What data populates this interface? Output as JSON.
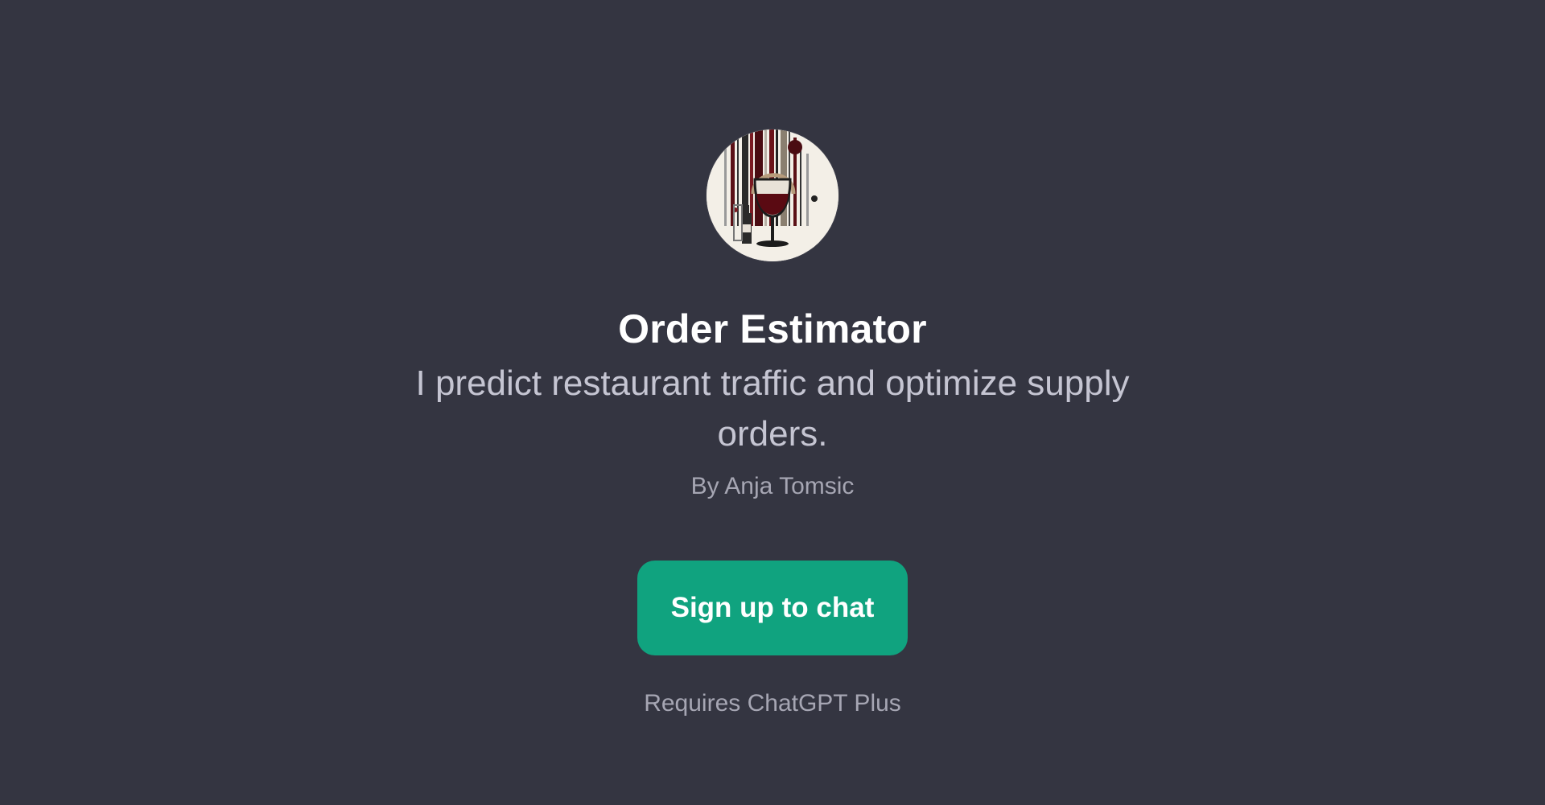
{
  "gpt": {
    "name": "Order Estimator",
    "description": "I predict restaurant traffic and optimize supply orders.",
    "author": "By Anja Tomsic",
    "avatar_icon": "wine-glass-icon"
  },
  "actions": {
    "signup_label": "Sign up to chat",
    "requirement_note": "Requires ChatGPT Plus"
  },
  "colors": {
    "background": "#343541",
    "accent": "#10a37f",
    "title": "#ffffff",
    "description": "#c5c5d2",
    "muted": "#a6a6b3"
  }
}
